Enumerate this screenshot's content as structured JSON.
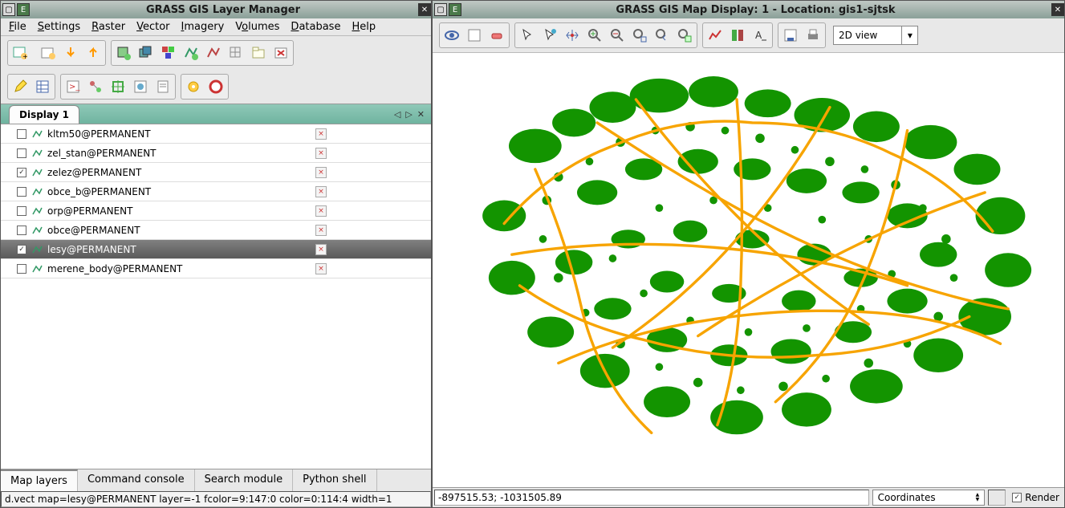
{
  "layerManager": {
    "title": "GRASS GIS Layer Manager",
    "menu": [
      "File",
      "Settings",
      "Raster",
      "Vector",
      "Imagery",
      "Volumes",
      "Database",
      "Help"
    ],
    "displayTab": "Display 1",
    "layers": [
      {
        "name": "kltm50@PERMANENT",
        "checked": false,
        "selected": false
      },
      {
        "name": "zel_stan@PERMANENT",
        "checked": false,
        "selected": false
      },
      {
        "name": "zelez@PERMANENT",
        "checked": true,
        "selected": false
      },
      {
        "name": "obce_b@PERMANENT",
        "checked": false,
        "selected": false
      },
      {
        "name": "orp@PERMANENT",
        "checked": false,
        "selected": false
      },
      {
        "name": "obce@PERMANENT",
        "checked": false,
        "selected": false
      },
      {
        "name": "lesy@PERMANENT",
        "checked": true,
        "selected": true
      },
      {
        "name": "merene_body@PERMANENT",
        "checked": false,
        "selected": false
      }
    ],
    "bottomTabs": [
      "Map layers",
      "Command console",
      "Search module",
      "Python shell"
    ],
    "status": "d.vect map=lesy@PERMANENT layer=-1 fcolor=9:147:0 color=0:114:4 width=1"
  },
  "mapDisplay": {
    "title": "GRASS GIS Map Display: 1  - Location: gis1-sjtsk",
    "viewMode": "2D view",
    "coordText": "-897515.53; -1031505.89",
    "coordLabel": "Coordinates",
    "renderLabel": "Render",
    "renderChecked": true
  }
}
